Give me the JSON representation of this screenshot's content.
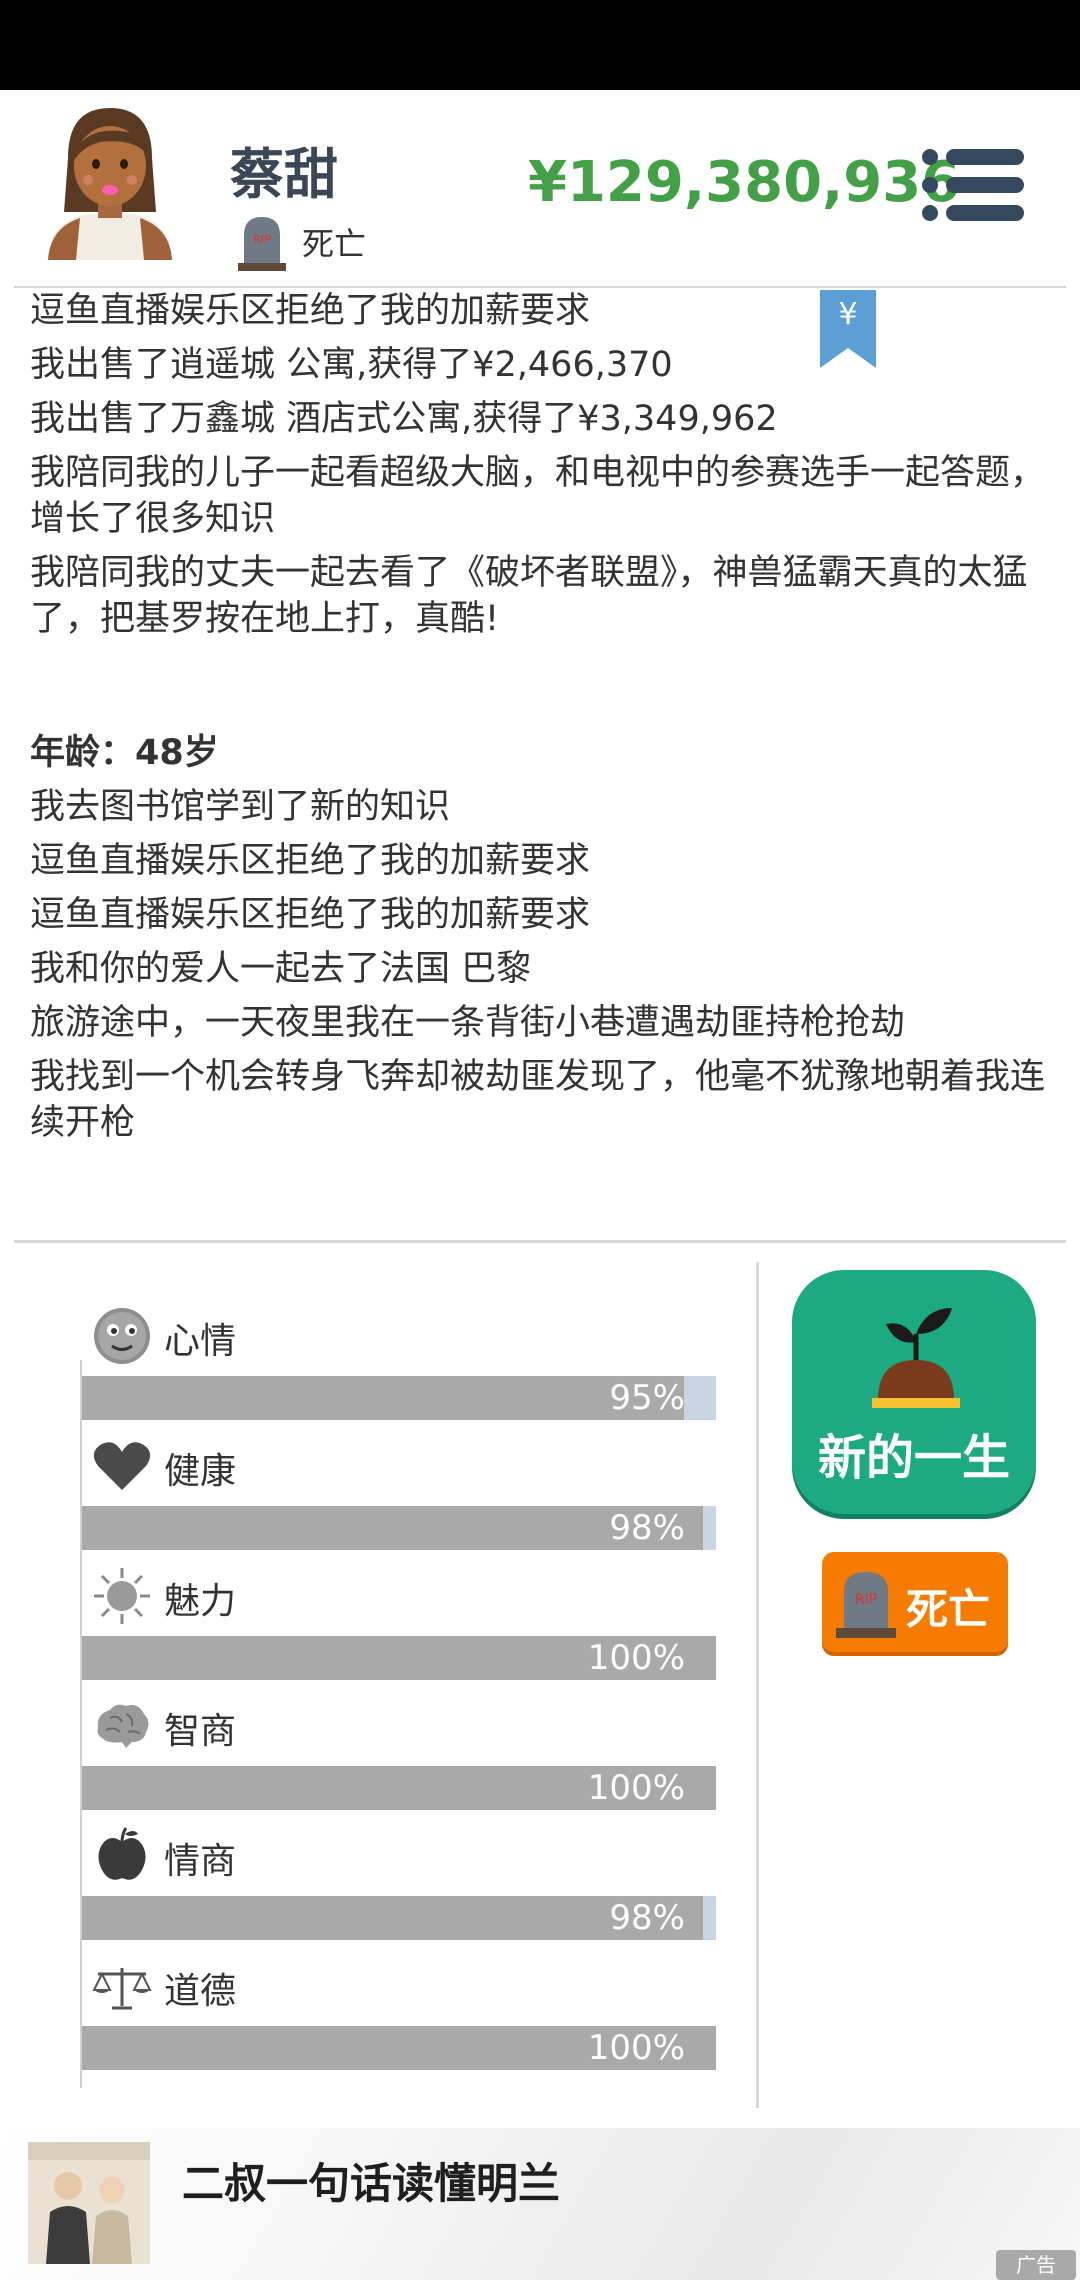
{
  "header": {
    "name": "蔡甜",
    "status": "死亡",
    "money": "¥129,380,936"
  },
  "log": {
    "entries_before": [
      "逗鱼直播娱乐区拒绝了我的加薪要求",
      "我出售了逍遥城 公寓,获得了¥2,466,370",
      "我出售了万鑫城 酒店式公寓,获得了¥3,349,962",
      "我陪同我的儿子一起看超级大脑，和电视中的参赛选手一起答题，增长了很多知识",
      "我陪同我的丈夫一起去看了《破坏者联盟》，神兽猛霸天真的太猛了，把基罗按在地上打，真酷!"
    ],
    "age_heading": "年龄：48岁",
    "entries_after": [
      "我去图书馆学到了新的知识",
      "逗鱼直播娱乐区拒绝了我的加薪要求",
      "逗鱼直播娱乐区拒绝了我的加薪要求",
      "我和你的爱人一起去了法国 巴黎",
      "旅游途中，一天夜里我在一条背街小巷遭遇劫匪持枪抢劫",
      "我找到一个机会转身飞奔却被劫匪发现了，他毫不犹豫地朝着我连续开枪"
    ],
    "bookmark_symbol": "¥"
  },
  "stats": [
    {
      "label": "心情",
      "value": 95,
      "pct": "95%",
      "icon": "smiley-face-icon"
    },
    {
      "label": "健康",
      "value": 98,
      "pct": "98%",
      "icon": "heart-icon"
    },
    {
      "label": "魅力",
      "value": 100,
      "pct": "100%",
      "icon": "sun-icon"
    },
    {
      "label": "智商",
      "value": 100,
      "pct": "100%",
      "icon": "brain-icon"
    },
    {
      "label": "情商",
      "value": 98,
      "pct": "98%",
      "icon": "apple-icon"
    },
    {
      "label": "道德",
      "value": 100,
      "pct": "100%",
      "icon": "scales-icon"
    }
  ],
  "actions": {
    "new_life": "新的一生",
    "dead": "死亡"
  },
  "ad": {
    "title": "二叔一句话读懂明兰",
    "badge": "广告"
  },
  "colors": {
    "money": "#43a047",
    "age": "#1e6fd0",
    "new_life_bg": "#1daa82",
    "dead_bg": "#f57c00",
    "bar_fill": "#a9a9a9",
    "bar_bg": "#c8d6e3"
  }
}
